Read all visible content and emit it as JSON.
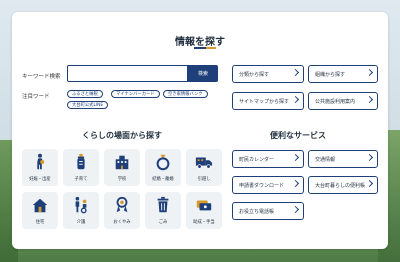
{
  "header": {
    "title": "情報を探す"
  },
  "search": {
    "label": "キーワード検索",
    "placeholder": "",
    "button_label": "検索"
  },
  "attention": {
    "label": "注目ワード",
    "tags": [
      "ふるさと納税",
      "マイナンバーカード",
      "空き家情報バンク",
      "大台町公式LINE"
    ]
  },
  "quick_links": [
    "分類から探す",
    "組織から探す",
    "サイトマップから探す",
    "公共施設利用案内"
  ],
  "life_scenes": {
    "title": "くらしの場面から探す",
    "items": [
      "妊娠・出産",
      "子育て",
      "学校",
      "結婚・離婚",
      "引越し",
      "住宅",
      "介護",
      "おくやみ",
      "ごみ",
      "助成・手当"
    ]
  },
  "services": {
    "title": "便利なサービス",
    "items": [
      "町民カレンダー",
      "交通情報",
      "申請書ダウンロード",
      "大台町暮らしの便利帳",
      "お役立ち電話帳"
    ]
  },
  "colors": {
    "accent": "#1e3f7a",
    "sub_accent": "#d69a2d",
    "tile_bg": "#eef2f5"
  }
}
